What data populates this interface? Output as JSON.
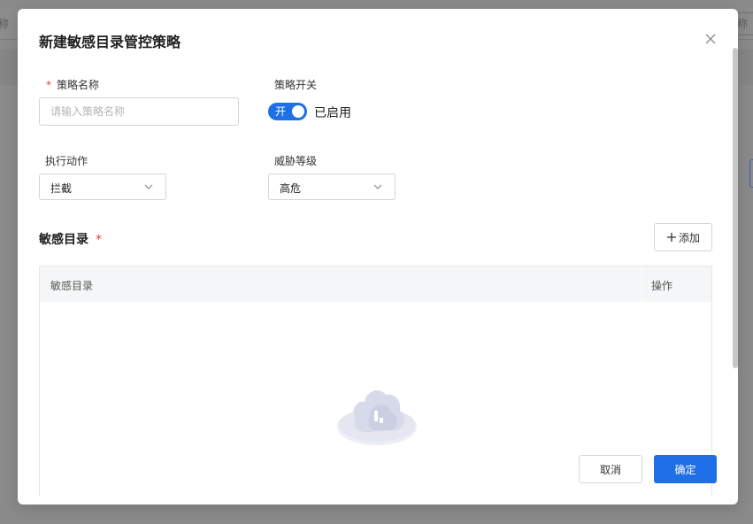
{
  "background": {
    "left_fragment": "称",
    "right_fragment": "称"
  },
  "modal": {
    "title": "新建敏感目录管控策略"
  },
  "form": {
    "name_label": "策略名称",
    "name_required_mark": "*",
    "name_placeholder": "请输入策略名称",
    "name_value": "",
    "switch_label": "策略开关",
    "switch_text": "开",
    "switch_state_text": "已启用",
    "switch_on": true,
    "action_label": "执行动作",
    "action_value": "拦截",
    "threat_label": "威胁等级",
    "threat_value": "高危"
  },
  "section": {
    "title": "敏感目录",
    "required_mark": "*",
    "add_label": "添加"
  },
  "table": {
    "columns": [
      "敏感目录",
      "操作"
    ],
    "rows": []
  },
  "footer": {
    "cancel_label": "取消",
    "confirm_label": "确定"
  },
  "colors": {
    "primary": "#1f6fe6",
    "required": "#f04134"
  }
}
